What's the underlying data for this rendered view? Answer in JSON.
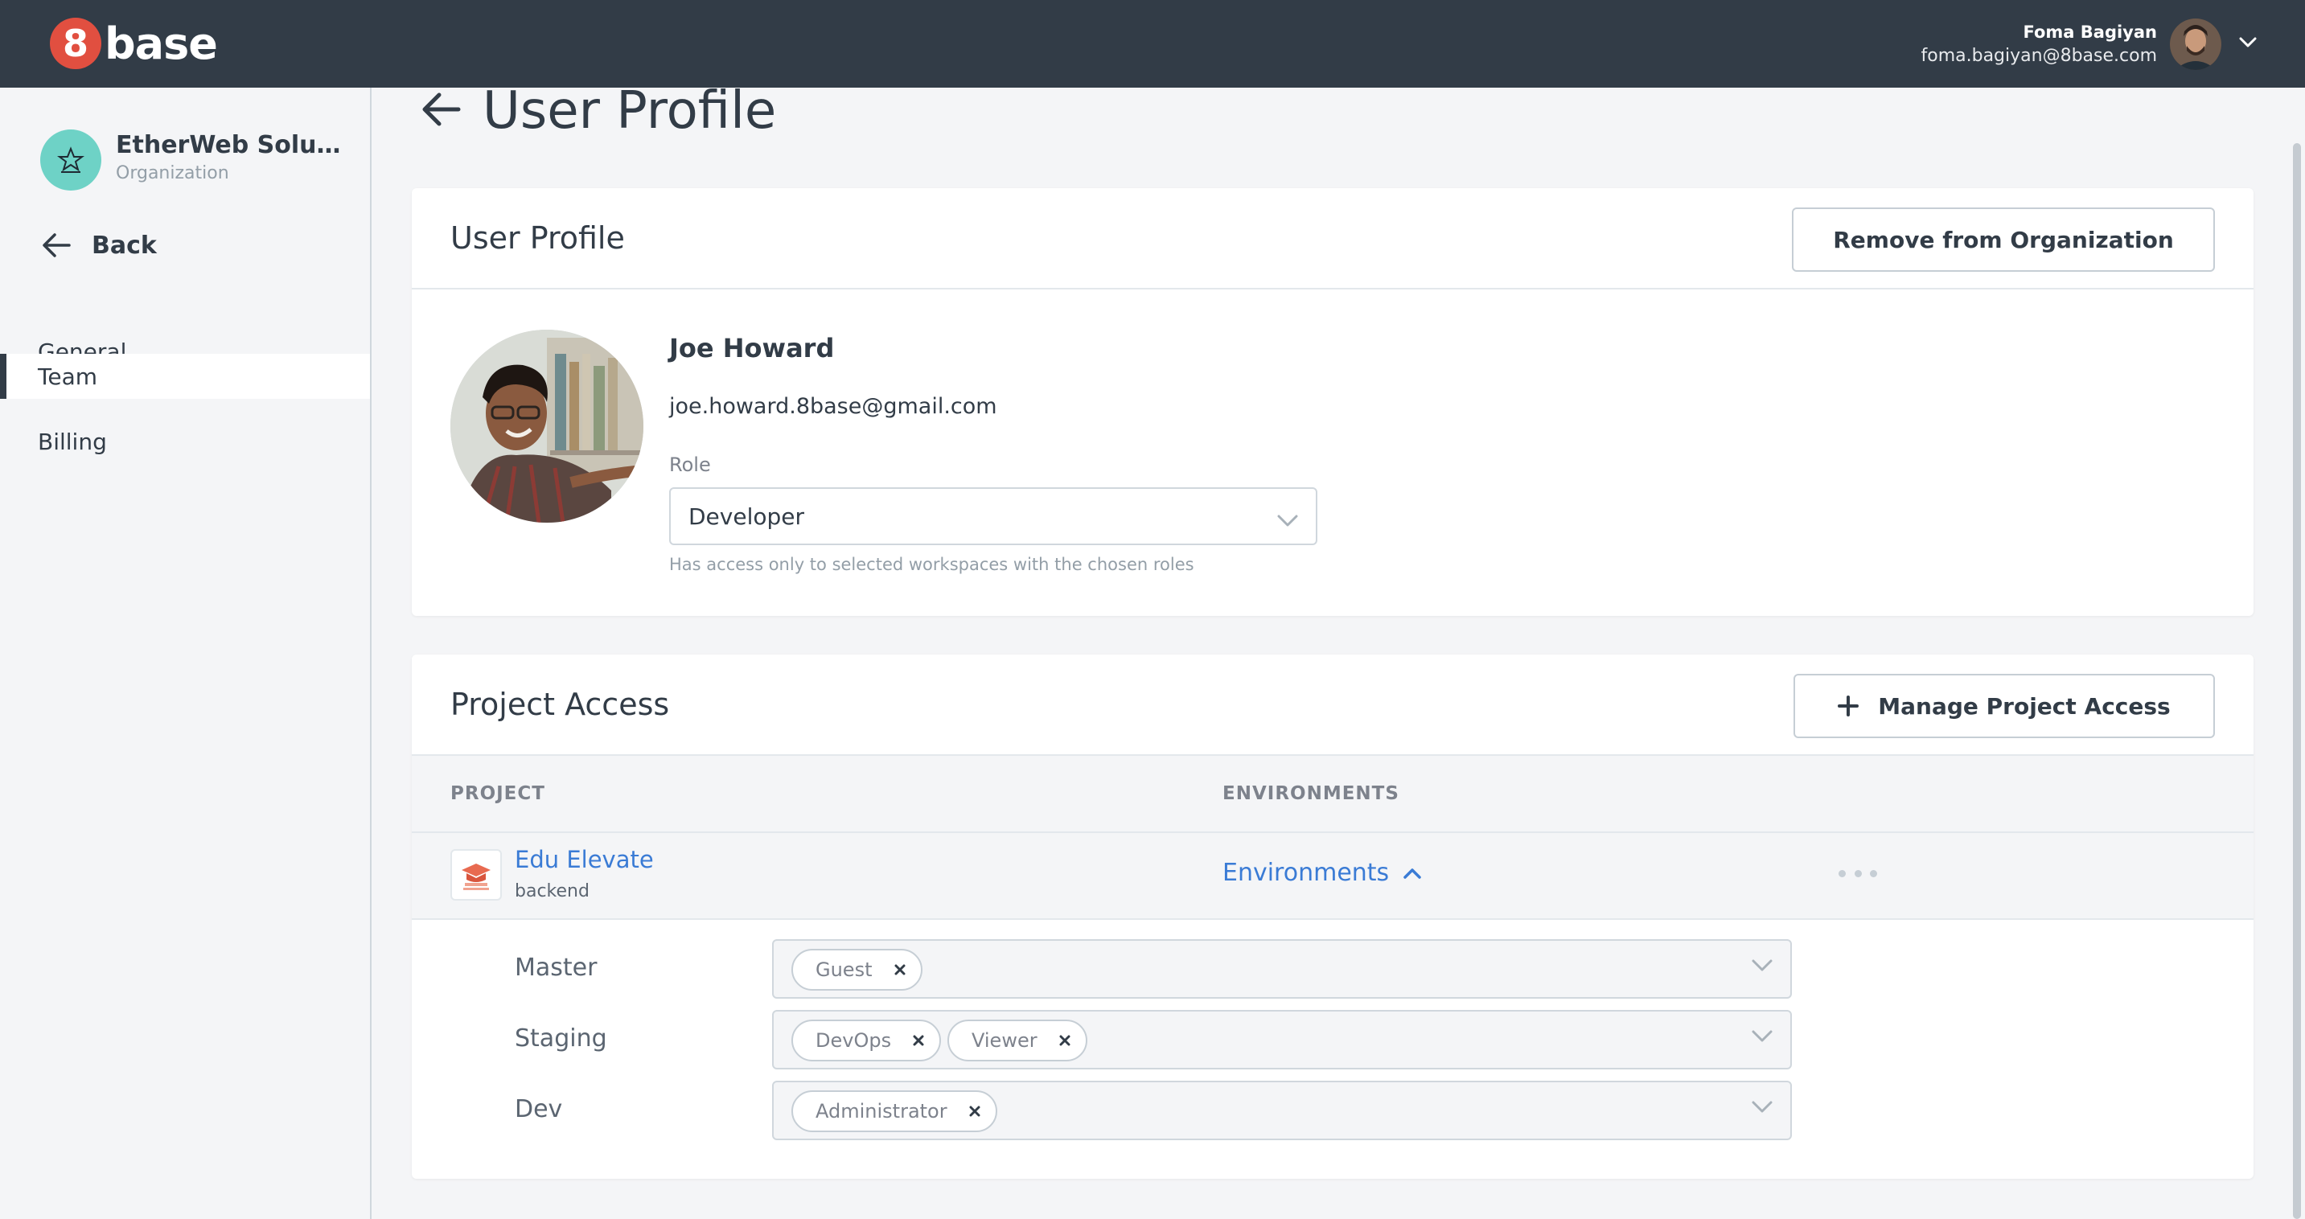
{
  "header": {
    "logo_number": "8",
    "logo_text": "base",
    "user_name": "Foma Bagiyan",
    "user_email": "foma.bagiyan@8base.com"
  },
  "sidebar": {
    "org_name": "EtherWeb Soluti...",
    "org_sub": "Organization",
    "back_label": "Back",
    "items": [
      {
        "label": "General",
        "active": false
      },
      {
        "label": "Team",
        "active": true
      },
      {
        "label": "Billing",
        "active": false
      }
    ]
  },
  "page": {
    "title": "User Profile"
  },
  "profile_card": {
    "title": "User Profile",
    "remove_button": "Remove from Organization",
    "name": "Joe Howard",
    "email": "joe.howard.8base@gmail.com",
    "role_label": "Role",
    "role_value": "Developer",
    "role_hint": "Has access only to selected workspaces with the chosen roles"
  },
  "access_card": {
    "title": "Project Access",
    "manage_button": "Manage Project Access",
    "columns": [
      "PROJECT",
      "ENVIRONMENTS"
    ],
    "project": {
      "name": "Edu Elevate",
      "sub": "backend",
      "env_toggle": "Environments"
    },
    "environments": [
      {
        "name": "Master",
        "roles": [
          "Guest"
        ]
      },
      {
        "name": "Staging",
        "roles": [
          "DevOps",
          "Viewer"
        ]
      },
      {
        "name": "Dev",
        "roles": [
          "Administrator"
        ]
      }
    ]
  },
  "colors": {
    "topbar": "#323c47",
    "brand": "#e14f40",
    "link": "#3a7bd5",
    "org_avatar": "#6ed2c6"
  }
}
